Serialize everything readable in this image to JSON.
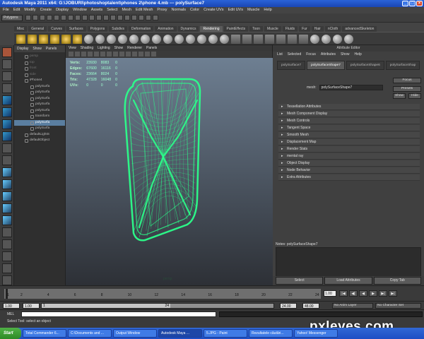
{
  "window": {
    "title": "Autodesk Maya 2011 x64: G:\\JOBURI\\photoshoptalent\\phones 2\\phone 4.mb --- polySurface7"
  },
  "menubar": [
    "File",
    "Edit",
    "Modify",
    "Create",
    "Display",
    "Window",
    "Assets",
    "Select",
    "Mesh",
    "Edit Mesh",
    "Proxy",
    "Normals",
    "Color",
    "Create UVs",
    "Edit UVs",
    "Muscle",
    "Help"
  ],
  "statusline": {
    "mode": "Polygons"
  },
  "shelf": {
    "tabs": [
      "Misc",
      "General",
      "Curves",
      "Surfaces",
      "Polygons",
      "Subdivs",
      "Deformation",
      "Animation",
      "Dynamics",
      "Rendering",
      "PaintEffects",
      "Toon",
      "Muscle",
      "Fluids",
      "Fur",
      "Hair",
      "nCloth",
      "advancedSkeleton"
    ],
    "active_tab": "Rendering"
  },
  "outliner": {
    "menu": [
      "Display",
      "Show",
      "Panels"
    ],
    "items": [
      {
        "label": "persp",
        "dim": true
      },
      {
        "label": "top",
        "dim": true
      },
      {
        "label": "front",
        "dim": true
      },
      {
        "label": "side",
        "dim": true
      },
      {
        "label": "iPhone4",
        "dim": false
      },
      {
        "label": "polySurfa",
        "dim": false
      },
      {
        "label": "polySurfa",
        "dim": false
      },
      {
        "label": "polySurfa",
        "dim": false
      },
      {
        "label": "polySurfa",
        "dim": false
      },
      {
        "label": "polySurfa",
        "dim": false
      },
      {
        "label": "transform",
        "dim": false
      },
      {
        "label": "polySurfa",
        "dim": false,
        "selected": true
      },
      {
        "label": "polySurfa",
        "dim": false
      },
      {
        "label": "defaultLightS",
        "dim": false
      },
      {
        "label": "defaultObject",
        "dim": false
      }
    ]
  },
  "viewport": {
    "menu": [
      "View",
      "Shading",
      "Lighting",
      "Show",
      "Renderer",
      "Panels"
    ],
    "hud": [
      {
        "label": "Verts:",
        "v1": "23930",
        "v2": "8083",
        "v3": "0"
      },
      {
        "label": "Edges:",
        "v1": "67600",
        "v2": "16116",
        "v3": "0"
      },
      {
        "label": "Faces:",
        "v1": "23664",
        "v2": "8024",
        "v3": "0"
      },
      {
        "label": "Tris:",
        "v1": "47328",
        "v2": "16048",
        "v3": "0"
      },
      {
        "label": "UVs:",
        "v1": "0",
        "v2": "0",
        "v3": "0"
      }
    ],
    "camera_label": "persp",
    "wire_color": "#2bff8a"
  },
  "attribute_editor": {
    "title": "Attribute Editor",
    "menu": [
      "List",
      "Selected",
      "Focus",
      "Attributes",
      "Show",
      "Help"
    ],
    "tabs": [
      "polySurface7",
      "polySurfaceShape7",
      "polySurfaceShape6",
      "polySurfaceShap"
    ],
    "active_tab": "polySurfaceShape7",
    "mesh_label": "mesh:",
    "mesh_value": "polySurfaceShape7",
    "side_buttons": [
      "Focus",
      "Presets",
      "Show",
      "Hide"
    ],
    "sections": [
      "Tessellation Attributes",
      "Mesh Component Display",
      "Mesh Controls",
      "Tangent Space",
      "Smooth Mesh",
      "Displacement Map",
      "Render Stats",
      "mental ray",
      "Object Display",
      "Node Behavior",
      "Extra Attributes"
    ],
    "notes_label": "Notes: polySurfaceShape7",
    "buttons": [
      "Select",
      "Load Attributes",
      "Copy Tab"
    ]
  },
  "timeslider": {
    "ticks": [
      "1",
      "2",
      "4",
      "6",
      "8",
      "10",
      "12",
      "14",
      "16",
      "18",
      "20",
      "22",
      "24"
    ],
    "current_frame": "1.00",
    "playback": [
      "|◀",
      "◀|",
      "◀",
      "▶",
      "▶|",
      "▶|"
    ]
  },
  "rangeslider": {
    "start": "1.00",
    "start2": "1.00",
    "handle_start": "1",
    "handle_end": "24",
    "end": "24.00",
    "end2": "48.00",
    "anim_layer": "No Anim Layer",
    "character_set": "No Character Set"
  },
  "cmdline": {
    "lang": "MEL"
  },
  "helpline": {
    "text": "Select Tool: select an object"
  },
  "taskbar": {
    "start_label": "Start",
    "tasks": [
      {
        "label": "Total Commander 6...",
        "active": false
      },
      {
        "label": "C:\\Documents and ...",
        "active": false
      },
      {
        "label": "Output Window",
        "active": false
      },
      {
        "label": "Autodesk Maya ...",
        "active": true
      },
      {
        "label": "5.JPG - Paint",
        "active": false
      },
      {
        "label": "Rezultatele căutări...",
        "active": false
      },
      {
        "label": "Yahoo! Messenger",
        "active": false
      }
    ]
  },
  "watermark": "pxleyes.com"
}
